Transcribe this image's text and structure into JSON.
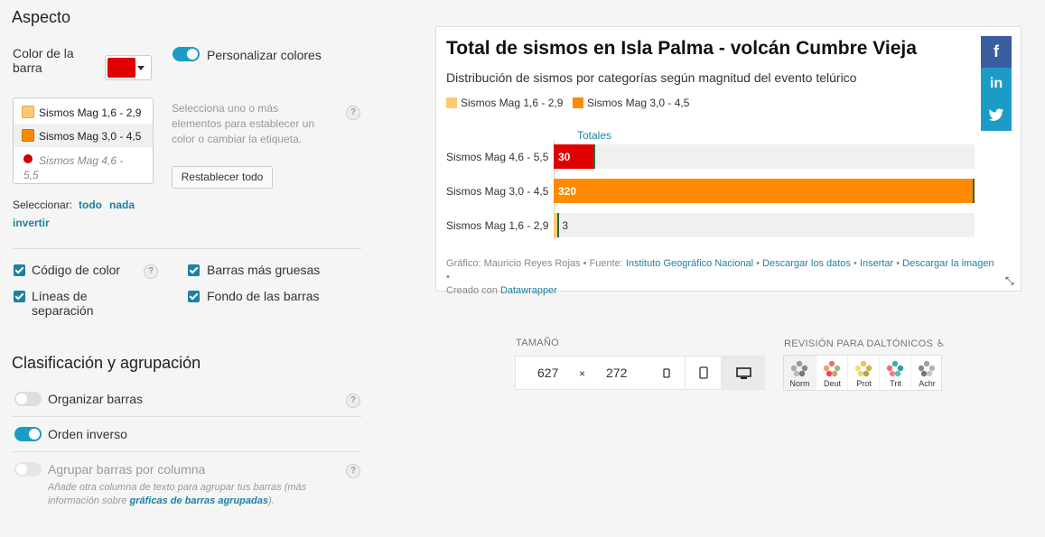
{
  "aspecto": {
    "heading": "Aspecto",
    "color_label": "Color de la barra",
    "bar_color": "#e00000",
    "customize_label": "Personalizar colores",
    "customize_on": true,
    "items": [
      {
        "label": "Sismos Mag 1,6 - 2,9",
        "color": "#ffc973"
      },
      {
        "label": "Sismos Mag 3,0 - 4,5",
        "color": "#ff8a00"
      },
      {
        "label": "Sismos Mag 4,6 - 5,5",
        "color": "#cc0000"
      }
    ],
    "hint": "Selecciona uno o más elementos para establecer un color o cambiar la etiqueta.",
    "reset_label": "Restablecer todo",
    "select_label": "Seleccionar:",
    "select_all": "todo",
    "select_none": "nada",
    "select_invert": "invertir",
    "checkboxes": {
      "color_code": "Código de color",
      "thicker": "Barras más gruesas",
      "separators": "Líneas de separación",
      "background": "Fondo de las barras"
    }
  },
  "sorting": {
    "heading": "Clasificación y agrupación",
    "sort_label": "Organizar barras",
    "reverse_label": "Orden inverso",
    "group_label": "Agrupar barras por columna",
    "group_hint_prefix": "Añade otra columna de texto para agrupar tus barras (más información sobre ",
    "group_hint_link": "gráficas de barras agrupadas",
    "group_hint_suffix": ")."
  },
  "chart": {
    "title": "Total de sismos en Isla Palma - volcán Cumbre Vieja",
    "subtitle": "Distribución de sismos por categorías según magnitud del evento telúrico",
    "column_header": "Totales",
    "footer_prefix": "Gráfico: Mauricio Reyes Rojas • Fuente: ",
    "footer_source": "Instituto Geográfico Nacional",
    "footer_links": [
      "Descargar los datos",
      "Insertar",
      "Descargar la imagen"
    ],
    "footer_created": "Creado con ",
    "footer_tool": "Datawrapper",
    "social": [
      "f",
      "in",
      "t"
    ]
  },
  "chart_data": {
    "type": "bar",
    "title": "Total de sismos en Isla Palma - volcán Cumbre Vieja",
    "subtitle": "Distribución de sismos por categorías según magnitud del evento telúrico",
    "categories": [
      "Sismos Mag 4,6 - 5,5",
      "Sismos Mag 3,0 - 4,5",
      "Sismos Mag 1,6 - 2,9"
    ],
    "values": [
      30,
      320,
      3
    ],
    "colors": [
      "#e00000",
      "#ff8a00",
      "#ffc973"
    ],
    "legend": [
      "Sismos Mag 1,6 - 2,9",
      "Sismos Mag 3,0 - 4,5"
    ],
    "column_header": "Totales",
    "xlim": [
      0,
      320
    ]
  },
  "size": {
    "label": "TAMAÑO",
    "width": "627",
    "times": "×",
    "height": "272"
  },
  "colorblind": {
    "label": "REVISIÓN PARA DALTÓNICOS",
    "modes": [
      "Norm",
      "Deut",
      "Prot",
      "Trit",
      "Achr"
    ]
  }
}
